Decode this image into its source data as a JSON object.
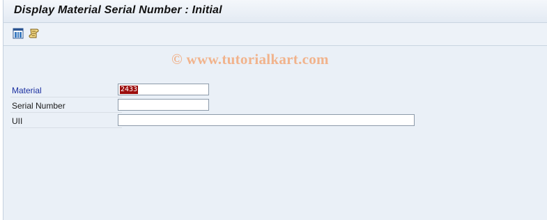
{
  "window": {
    "title": "Display Material Serial Number : Initial"
  },
  "toolbar": {
    "buttons": [
      {
        "icon": "hierarchy-icon"
      },
      {
        "icon": "script-icon"
      }
    ]
  },
  "watermark": "© www.tutorialkart.com",
  "form": {
    "material": {
      "label": "Material",
      "value": "2433",
      "required": true
    },
    "serial_number": {
      "label": "Serial Number",
      "value": ""
    },
    "uii": {
      "label": "UII",
      "value": ""
    }
  },
  "colors": {
    "required_label": "#1a2fa0",
    "selection_highlight": "#9c0d0d",
    "background": "#eaf0f7"
  }
}
